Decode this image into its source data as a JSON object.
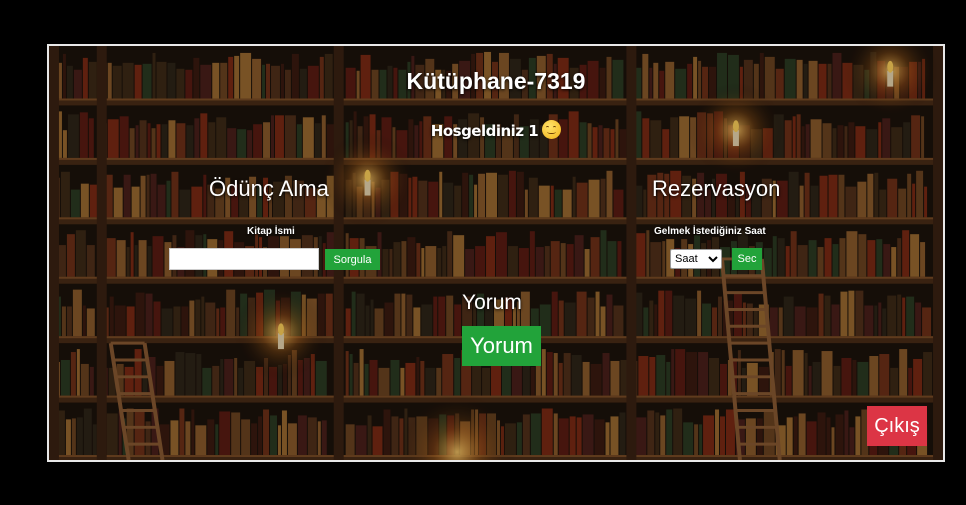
{
  "header": {
    "title": "Kütüphane-7319",
    "welcome": "Hosgeldiniz 1"
  },
  "borrow": {
    "title": "Ödünç Alma",
    "book_label": "Kitap İsmi",
    "book_value": "",
    "query_button": "Sorgula"
  },
  "reservation": {
    "title": "Rezervasyon",
    "time_label": "Gelmek İstediğiniz Saat",
    "time_selected": "Saat",
    "select_button": "Sec"
  },
  "comment": {
    "title": "Yorum",
    "button": "Yorum"
  },
  "logout": {
    "button": "Çıkış"
  },
  "icons": {
    "welcome_emoji": "smiling-face-icon"
  },
  "colors": {
    "green": "#22a33a",
    "red": "#dc3545",
    "frame_border": "#e8e8e8"
  }
}
